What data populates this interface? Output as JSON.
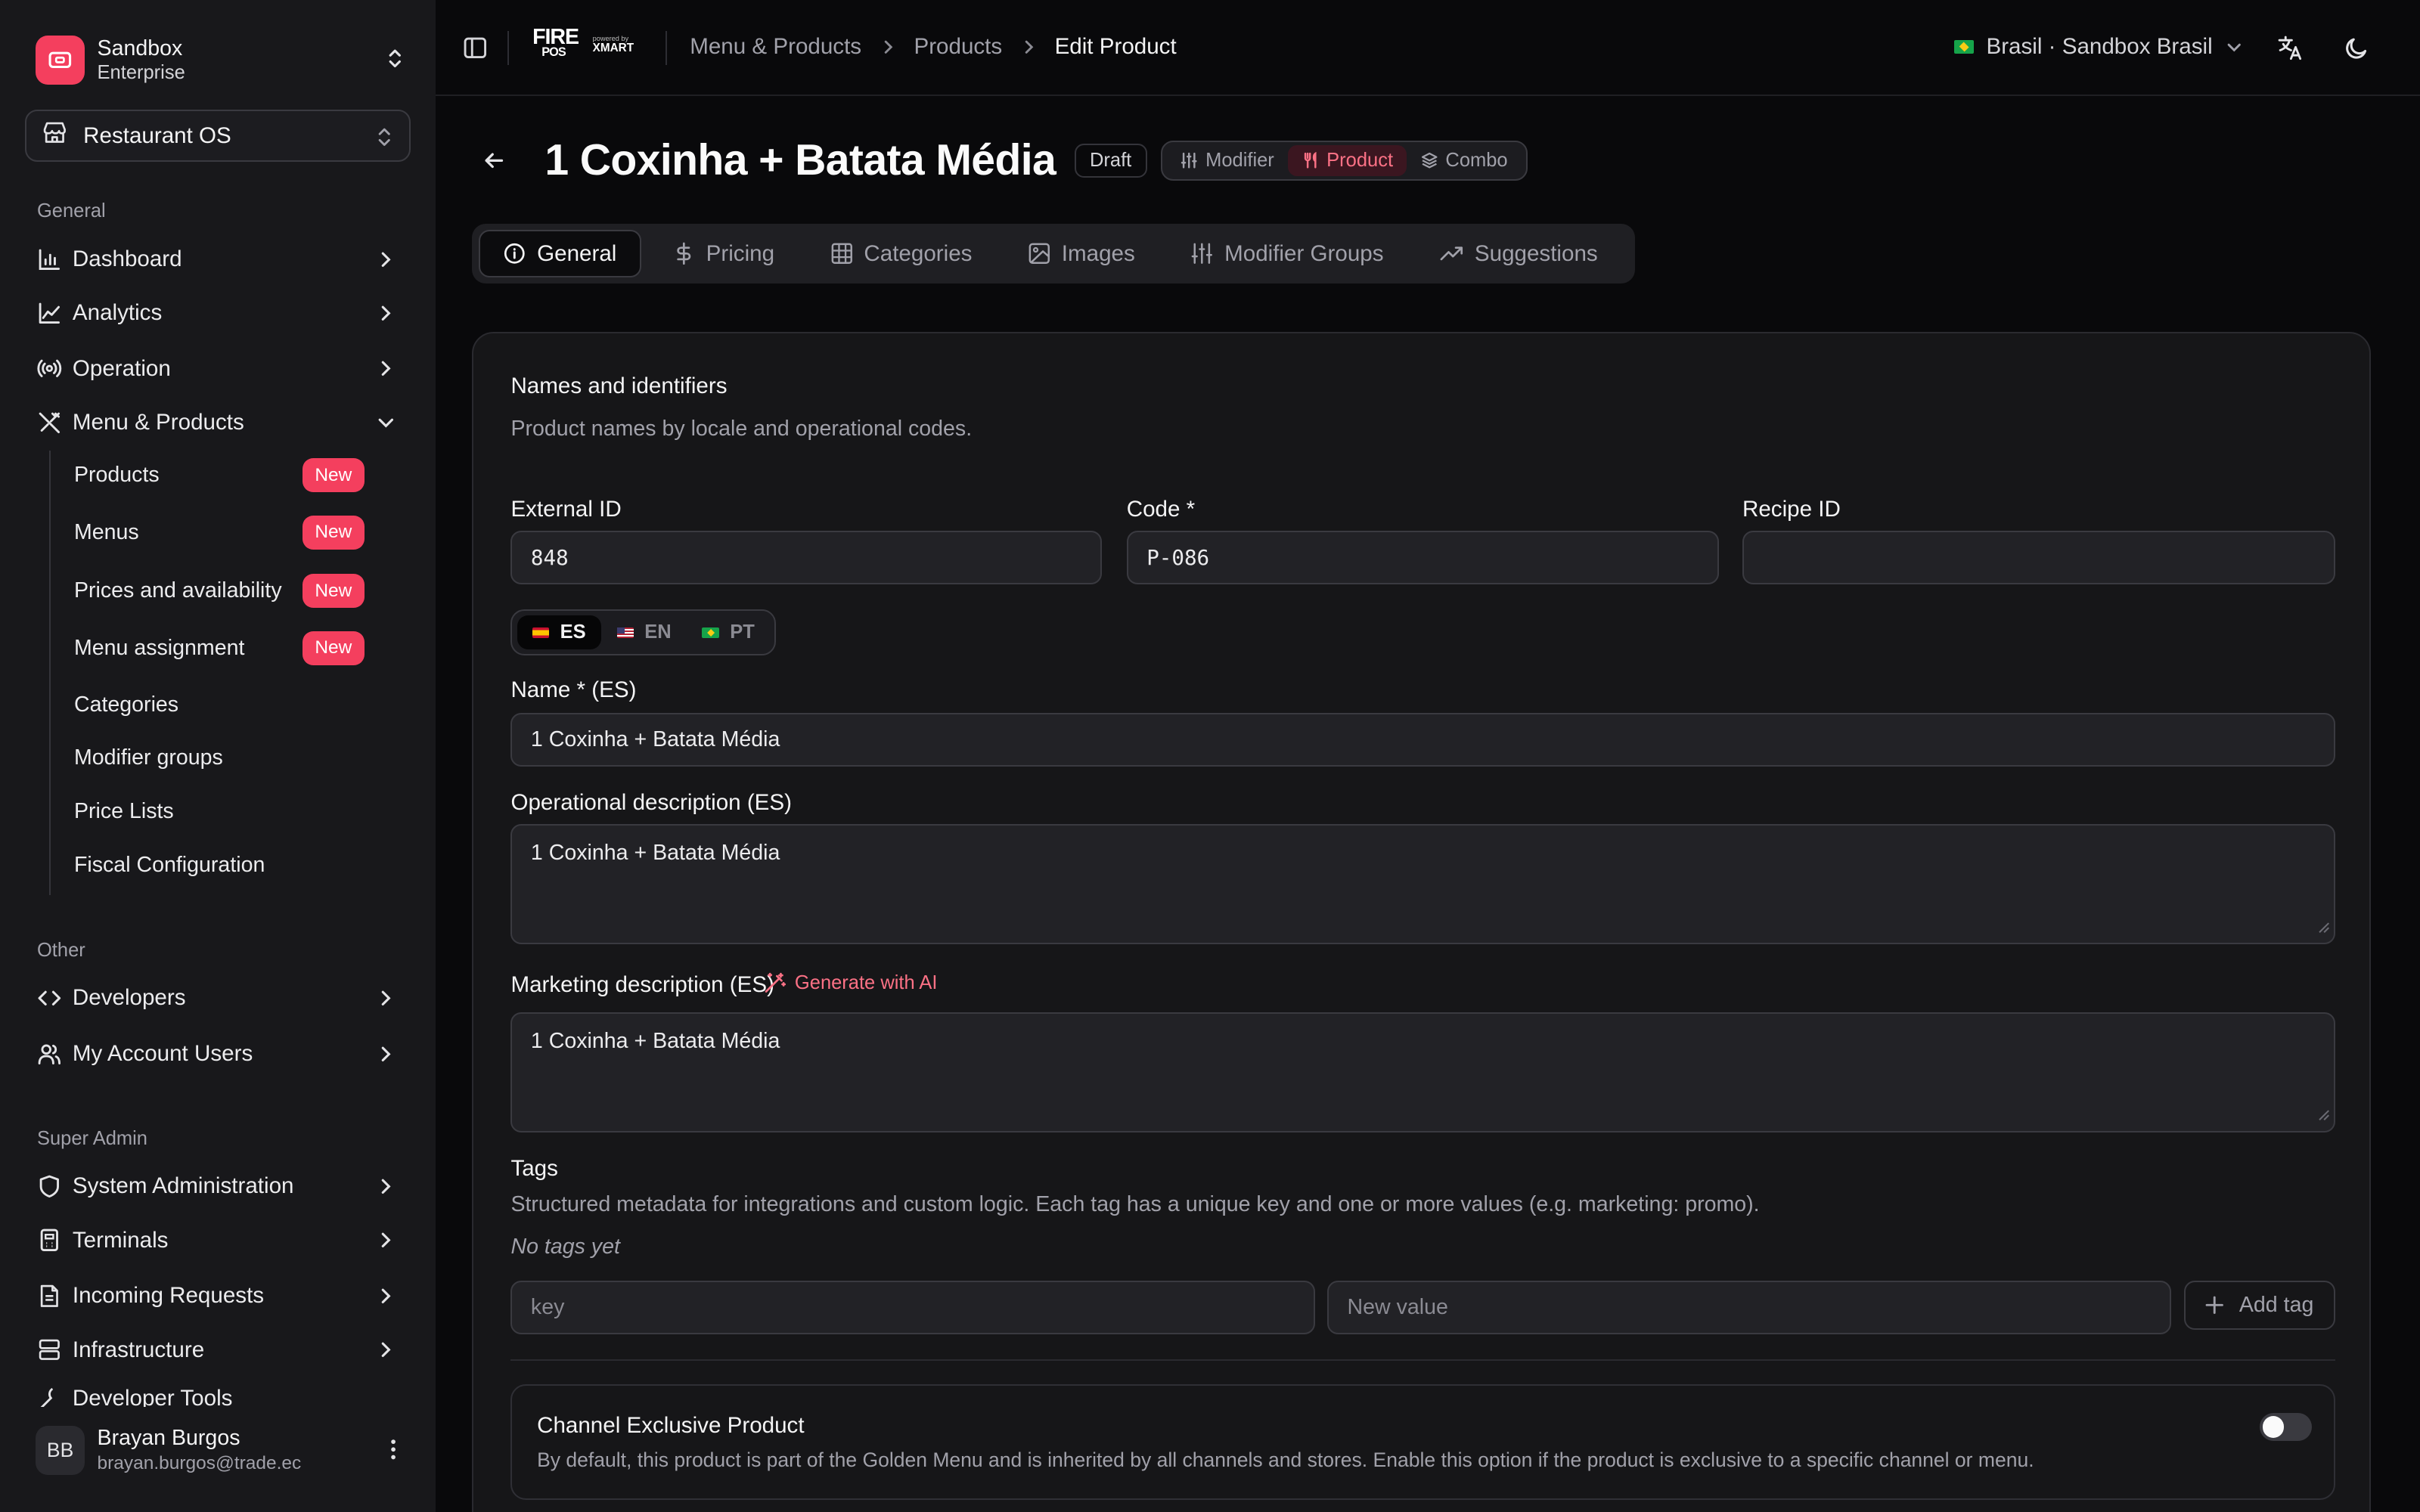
{
  "org": {
    "name": "Sandbox",
    "plan": "Enterprise"
  },
  "app_selector": {
    "label": "Restaurant OS"
  },
  "sidebar": {
    "general_label": "General",
    "general": [
      {
        "label": "Dashboard",
        "icon": "bar-chart-icon"
      },
      {
        "label": "Analytics",
        "icon": "line-chart-icon"
      },
      {
        "label": "Operation",
        "icon": "radio-icon"
      },
      {
        "label": "Menu & Products",
        "icon": "utensils-icon",
        "expanded": true
      }
    ],
    "menu_products_items": [
      {
        "label": "Products",
        "badge": "New"
      },
      {
        "label": "Menus",
        "badge": "New"
      },
      {
        "label": "Prices and availability",
        "badge": "New"
      },
      {
        "label": "Menu assignment",
        "badge": "New"
      },
      {
        "label": "Categories"
      },
      {
        "label": "Modifier groups"
      },
      {
        "label": "Price Lists"
      },
      {
        "label": "Fiscal Configuration"
      }
    ],
    "other_label": "Other",
    "other": [
      {
        "label": "Developers",
        "icon": "code-icon"
      },
      {
        "label": "My Account Users",
        "icon": "users-icon"
      }
    ],
    "super_admin_label": "Super Admin",
    "super_admin": [
      {
        "label": "System Administration",
        "icon": "shield-icon"
      },
      {
        "label": "Terminals",
        "icon": "terminal-icon"
      },
      {
        "label": "Incoming Requests",
        "icon": "file-icon"
      },
      {
        "label": "Infrastructure",
        "icon": "server-icon"
      },
      {
        "label": "Developer Tools",
        "icon": "tool-icon"
      }
    ]
  },
  "user": {
    "initials": "BB",
    "name": "Brayan Burgos",
    "email": "brayan.burgos@trade.ec"
  },
  "brand": {
    "name": "FIRE",
    "sub": "POS",
    "powered_by": "powered by",
    "partner": "XMART"
  },
  "breadcrumb": [
    "Menu & Products",
    "Products",
    "Edit Product"
  ],
  "region": {
    "label": "Brasil · Sandbox Brasil"
  },
  "page": {
    "title": "1 Coxinha + Batata Média",
    "status": "Draft",
    "type_options": [
      "Modifier",
      "Product",
      "Combo"
    ],
    "type_selected": "Product"
  },
  "tabs": [
    "General",
    "Pricing",
    "Categories",
    "Images",
    "Modifier Groups",
    "Suggestions"
  ],
  "active_tab": "General",
  "form": {
    "section_title": "Names and identifiers",
    "section_subtitle": "Product names by locale and operational codes.",
    "external_id": {
      "label": "External ID",
      "value": "848"
    },
    "code": {
      "label": "Code *",
      "value": "P-086"
    },
    "recipe_id": {
      "label": "Recipe ID",
      "value": ""
    },
    "languages": [
      "ES",
      "EN",
      "PT"
    ],
    "language_selected": "ES",
    "name": {
      "label": "Name * (ES)",
      "value": "1 Coxinha + Batata Média"
    },
    "operational_description": {
      "label": "Operational description (ES)",
      "value": "1 Coxinha + Batata Média"
    },
    "marketing_description": {
      "label": "Marketing description (ES)",
      "value": "1 Coxinha + Batata Média"
    },
    "generate_ai_label": "Generate with AI",
    "tags": {
      "label": "Tags",
      "help": "Structured metadata for integrations and custom logic. Each tag has a unique key and one or more values (e.g. marketing: promo).",
      "empty": "No tags yet",
      "key_placeholder": "key",
      "value_placeholder": "New value",
      "add_label": "Add tag"
    },
    "channel_exclusive": {
      "title": "Channel Exclusive Product",
      "description": "By default, this product is part of the Golden Menu and is inherited by all channels and stores. Enable this option if the product is exclusive to a specific channel or menu.",
      "enabled": false
    }
  },
  "colors": {
    "accent": "#f43f5e",
    "background": "#09090b",
    "sidebar": "#18181b"
  }
}
